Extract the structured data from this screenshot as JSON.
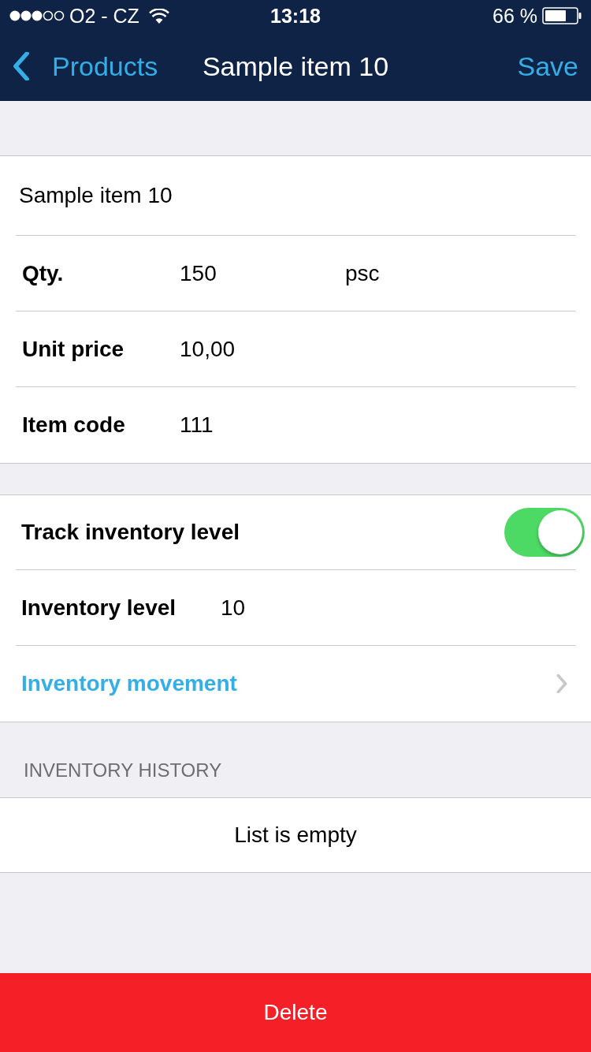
{
  "status_bar": {
    "carrier": "O2 - CZ",
    "time": "13:18",
    "battery": "66 %"
  },
  "nav_bar": {
    "back_label": "Products",
    "title": "Sample item 10",
    "action": "Save"
  },
  "item_name": {
    "value": "Sample item 10"
  },
  "fields": [
    {
      "label": "Qty.",
      "value": "150",
      "unit": "psc"
    },
    {
      "label": "Unit price",
      "value": "10,00"
    },
    {
      "label": "Item code",
      "value": "111"
    }
  ],
  "inventory": {
    "track": {
      "label": "Track inventory level",
      "on": true
    },
    "level": {
      "label": "Inventory level",
      "value": "10"
    },
    "movement": {
      "label": "Inventory movement"
    }
  },
  "history": {
    "header": "INVENTORY HISTORY",
    "empty_text": "List is empty"
  },
  "delete_button": {
    "label": "Delete"
  }
}
